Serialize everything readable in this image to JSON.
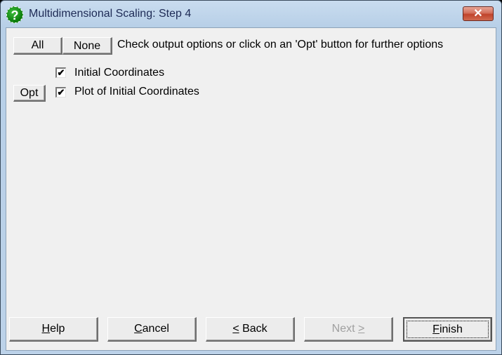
{
  "window": {
    "title": "Multidimensional Scaling: Step 4",
    "icon": "help-question-icon",
    "close_label": "✕"
  },
  "toolbar": {
    "all_label": "All",
    "none_label": "None",
    "instruction": "Check output options or click on an 'Opt' button for further options"
  },
  "options": [
    {
      "label": "Initial Coordinates",
      "checked": true,
      "has_opt": false
    },
    {
      "label": "Plot of Initial Coordinates",
      "checked": true,
      "has_opt": true,
      "opt_label": "Opt"
    }
  ],
  "check_glyph": "✔",
  "footer": {
    "help": {
      "mnemonic": "H",
      "rest": "elp"
    },
    "cancel": {
      "mnemonic": "C",
      "rest": "ancel"
    },
    "back": {
      "mnemonic": "<",
      "rest": " Back"
    },
    "next": {
      "label": "Next ",
      "mnemonic": ">",
      "disabled": true
    },
    "finish": {
      "mnemonic": "F",
      "rest": "inish",
      "default": true
    }
  }
}
